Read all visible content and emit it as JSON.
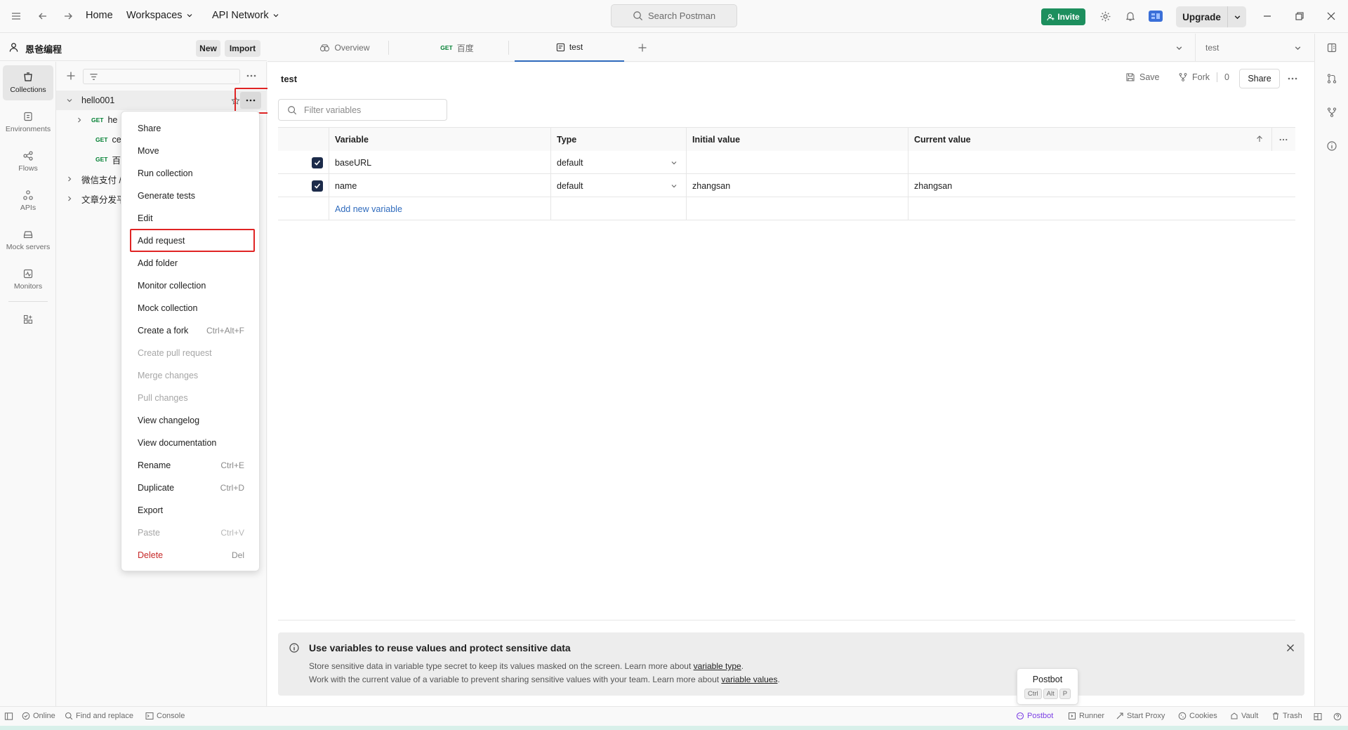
{
  "topbar": {
    "nav": {
      "home": "Home",
      "workspaces": "Workspaces",
      "api_network": "API Network"
    },
    "search_placeholder": "Search Postman",
    "invite_label": "Invite",
    "upgrade_label": "Upgrade"
  },
  "workspace": {
    "name": "恩爸编程",
    "new_label": "New",
    "import_label": "Import"
  },
  "rail": {
    "items": [
      {
        "label": "Collections",
        "icon": "collections-icon"
      },
      {
        "label": "Environments",
        "icon": "environments-icon"
      },
      {
        "label": "Flows",
        "icon": "flows-icon"
      },
      {
        "label": "APIs",
        "icon": "apis-icon"
      },
      {
        "label": "Mock servers",
        "icon": "mock-servers-icon"
      },
      {
        "label": "Monitors",
        "icon": "monitors-icon"
      }
    ]
  },
  "collections": {
    "tree": [
      {
        "label": "hello001",
        "level": 0,
        "expanded": true
      },
      {
        "method": "GET",
        "label": "he",
        "level": 1
      },
      {
        "method": "GET",
        "label": "ce",
        "level": 1
      },
      {
        "method": "GET",
        "label": "百",
        "level": 1
      },
      {
        "label": "微信支付 /",
        "level": 0,
        "expanded": false
      },
      {
        "label": "文章分发平",
        "level": 0,
        "expanded": false
      }
    ]
  },
  "context_menu": {
    "items": [
      {
        "label": "Share",
        "shortcut": ""
      },
      {
        "label": "Move",
        "shortcut": ""
      },
      {
        "label": "Run collection",
        "shortcut": ""
      },
      {
        "label": "Generate tests",
        "shortcut": ""
      },
      {
        "label": "Edit",
        "shortcut": ""
      },
      {
        "label": "Add request",
        "shortcut": ""
      },
      {
        "label": "Add folder",
        "shortcut": ""
      },
      {
        "label": "Monitor collection",
        "shortcut": ""
      },
      {
        "label": "Mock collection",
        "shortcut": ""
      },
      {
        "label": "Create a fork",
        "shortcut": "Ctrl+Alt+F"
      },
      {
        "label": "Create pull request",
        "shortcut": ""
      },
      {
        "label": "Merge changes",
        "shortcut": ""
      },
      {
        "label": "Pull changes",
        "shortcut": ""
      },
      {
        "label": "View changelog",
        "shortcut": ""
      },
      {
        "label": "View documentation",
        "shortcut": ""
      },
      {
        "label": "Rename",
        "shortcut": "Ctrl+E"
      },
      {
        "label": "Duplicate",
        "shortcut": "Ctrl+D"
      },
      {
        "label": "Export",
        "shortcut": ""
      },
      {
        "label": "Paste",
        "shortcut": "Ctrl+V"
      },
      {
        "label": "Delete",
        "shortcut": "Del"
      }
    ]
  },
  "tabs": {
    "items": [
      {
        "label": "Overview",
        "method": ""
      },
      {
        "label": "百度",
        "method": "GET"
      },
      {
        "label": "test",
        "method": ""
      }
    ],
    "environment": "test"
  },
  "main": {
    "title": "test",
    "save_label": "Save",
    "fork_label": "Fork",
    "fork_count": "0",
    "share_label": "Share",
    "filter_placeholder": "Filter variables",
    "columns": [
      "Variable",
      "Type",
      "Initial value",
      "Current value"
    ],
    "rows": [
      {
        "variable": "baseURL",
        "type": "default",
        "initial": "",
        "current": ""
      },
      {
        "variable": "name",
        "type": "default",
        "initial": "zhangsan",
        "current": "zhangsan"
      }
    ],
    "add_variable_label": "Add new variable"
  },
  "banner": {
    "title": "Use variables to reuse values and protect sensitive data",
    "line1_text": "Store sensitive data in variable type secret to keep its values masked on the screen. Learn more about ",
    "line1_link": "variable type",
    "line1_end": ".",
    "line2_text": "Work with the current value of a variable to prevent sharing sensitive values with your team. Learn more about ",
    "line2_link": "variable values",
    "line2_end": "."
  },
  "postbot_tip": {
    "title": "Postbot",
    "keys": [
      "Ctrl",
      "Alt",
      "P"
    ]
  },
  "statusbar": {
    "online": "Online",
    "find_replace": "Find and replace",
    "console": "Console",
    "postbot": "Postbot",
    "runner": "Runner",
    "start_proxy": "Start Proxy",
    "cookies": "Cookies",
    "vault": "Vault",
    "trash": "Trash"
  },
  "colors": {
    "accent_blue": "#2f6bbd",
    "invite_green": "#1d8f5e",
    "get_green": "#007f31",
    "danger_red": "#c62828",
    "highlight_red": "#e02424",
    "postbot_purple": "#7b3fe4"
  }
}
